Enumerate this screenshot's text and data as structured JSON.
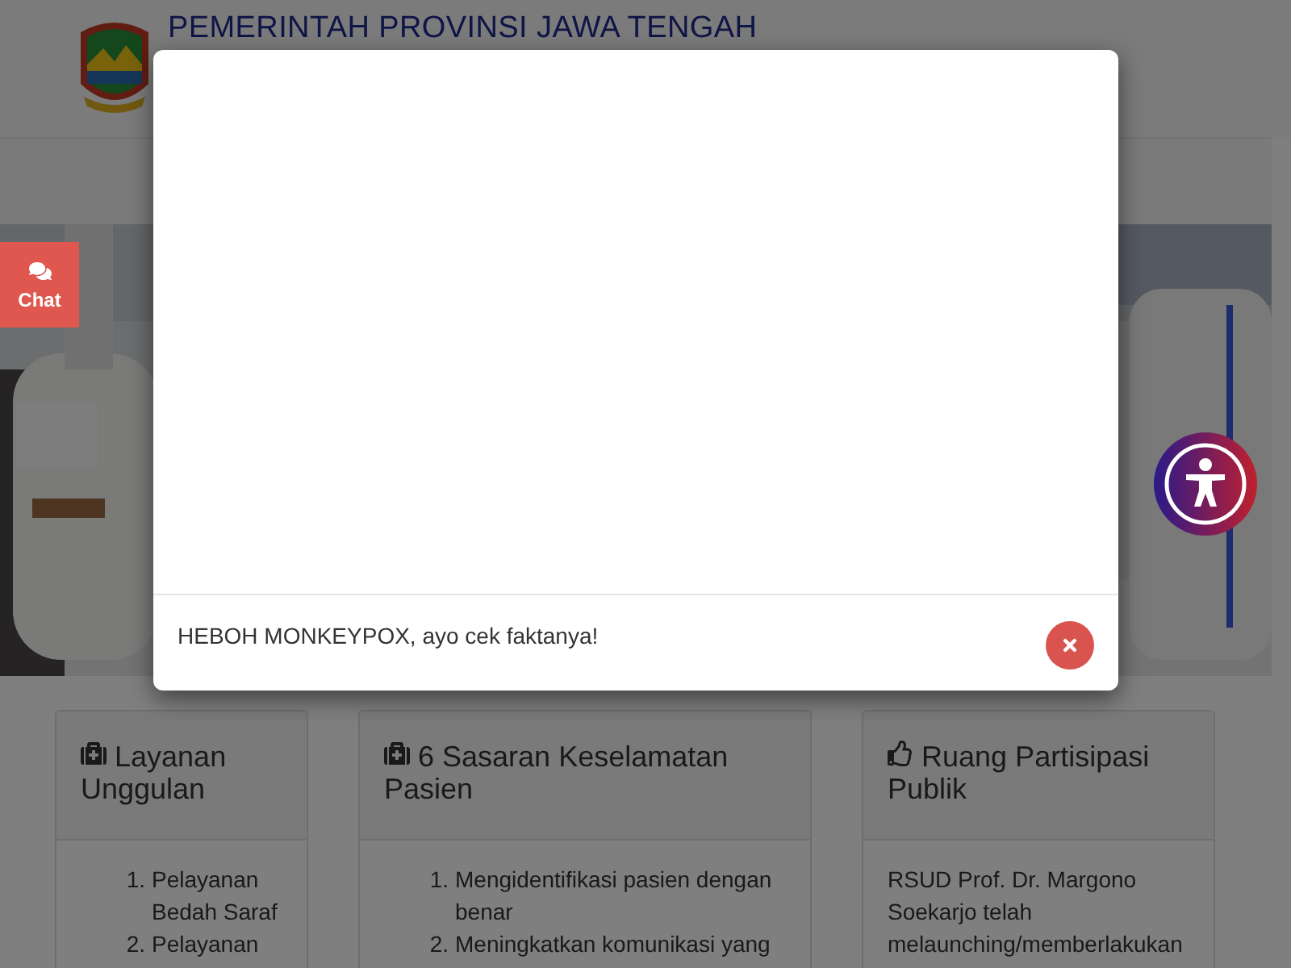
{
  "header": {
    "title": "PEMERINTAH PROVINSI JAWA TENGAH"
  },
  "chat_button": {
    "label": "Chat"
  },
  "cards": [
    {
      "kind": "list",
      "title": "Layanan Unggulan",
      "items": [
        {
          "number": "1.",
          "text": "Pelayanan Bedah Saraf"
        },
        {
          "number": "2.",
          "text": "Pelayanan"
        }
      ]
    },
    {
      "kind": "list",
      "title": "6 Sasaran Keselamatan Pasien",
      "items": [
        {
          "number": "1.",
          "text": "Mengidentifikasi pasien dengan benar"
        },
        {
          "number": "2.",
          "text": "Meningkatkan komunikasi yang"
        }
      ]
    },
    {
      "kind": "paragraph",
      "title": "Ruang Partisipasi Publik",
      "text": "RSUD Prof. Dr. Margono Soekarjo telah melaunching/memberlakukan"
    }
  ],
  "modal": {
    "message": "HEBOH MONKEYPOX, ayo cek faktanya!"
  }
}
